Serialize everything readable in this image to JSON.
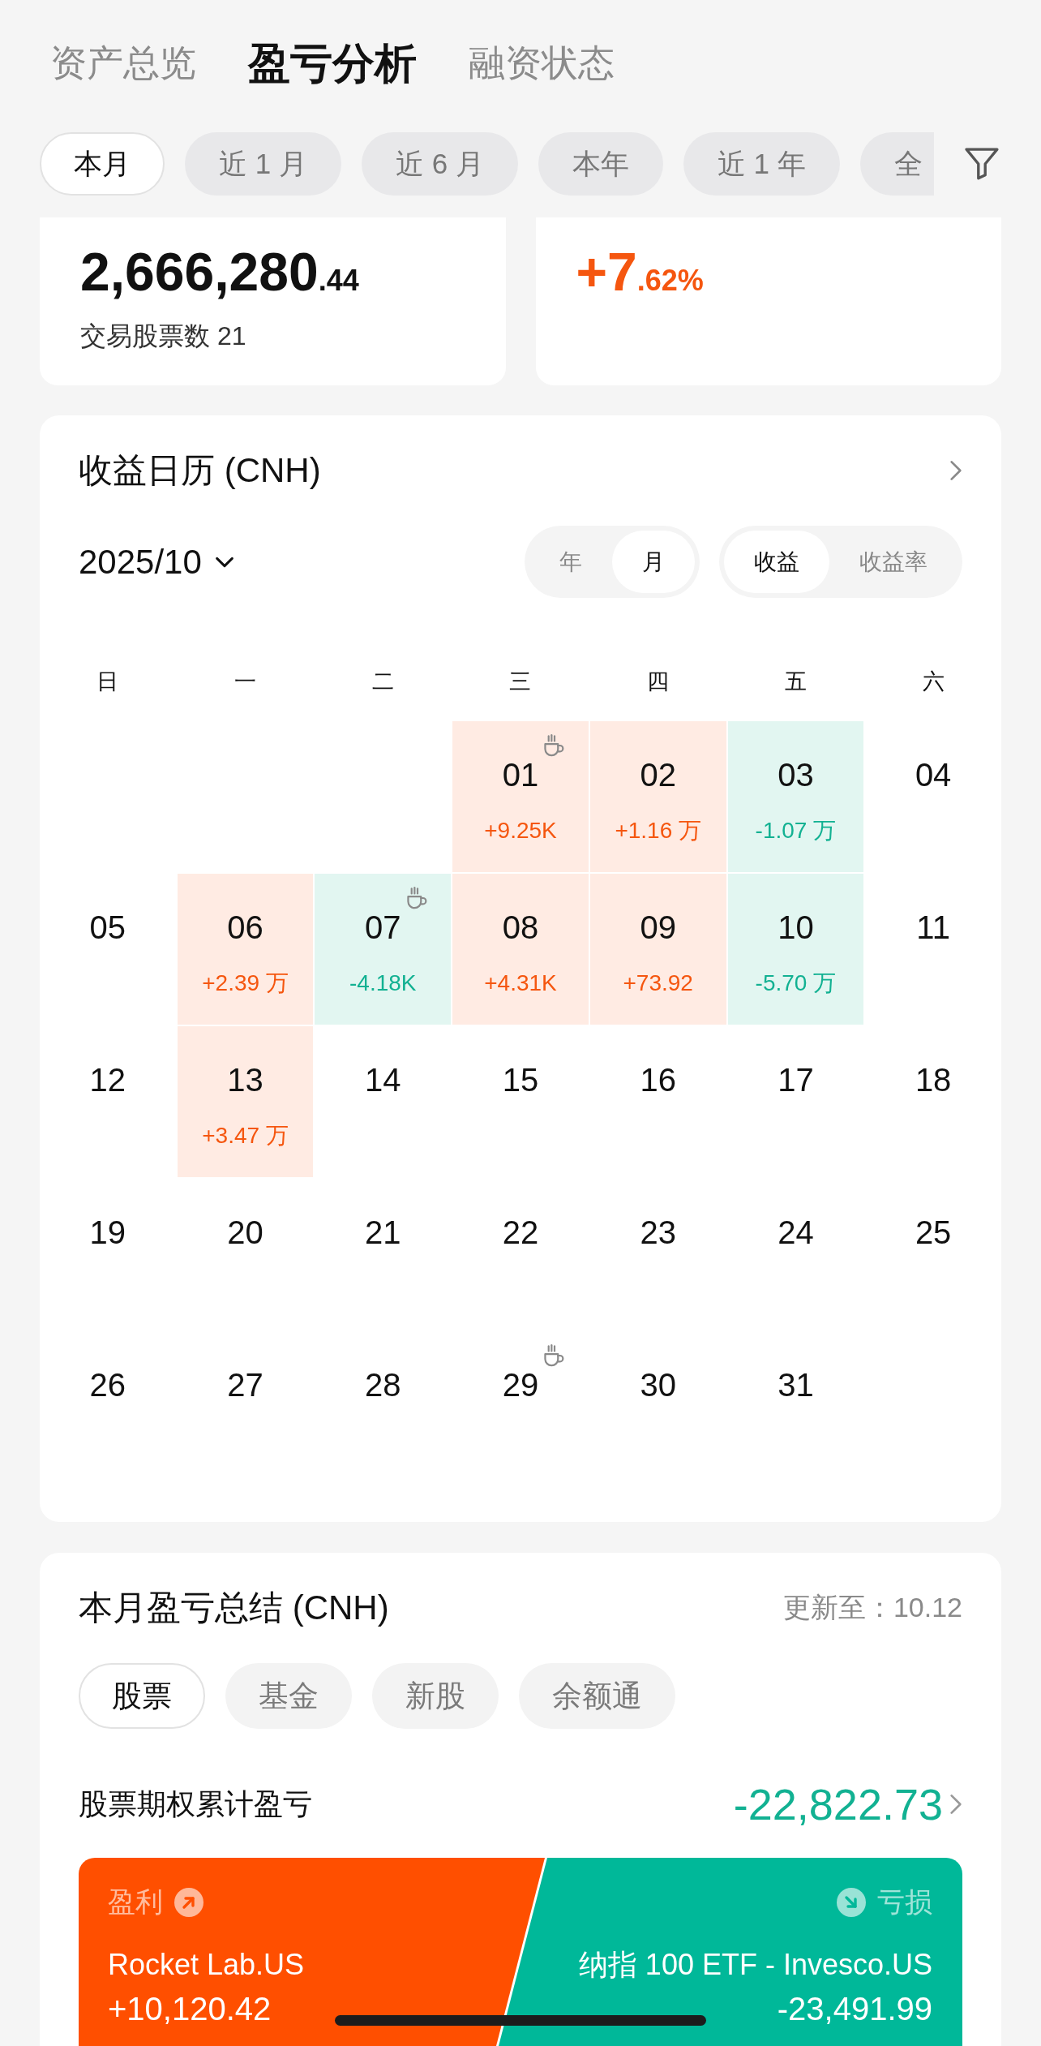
{
  "top_tabs": [
    {
      "label": "资产总览",
      "selected": false
    },
    {
      "label": "盈亏分析",
      "selected": true
    },
    {
      "label": "融资状态",
      "selected": false
    }
  ],
  "period_chips": [
    {
      "label": "本月",
      "selected": true
    },
    {
      "label": "近 1 月",
      "selected": false
    },
    {
      "label": "近 6 月",
      "selected": false
    },
    {
      "label": "本年",
      "selected": false
    },
    {
      "label": "近 1 年",
      "selected": false
    },
    {
      "label": "全",
      "selected": false
    }
  ],
  "stat_cards": [
    {
      "kind": "plain",
      "value": "2,666,280",
      "decimals": ".44",
      "caption": "交易股票数 21"
    },
    {
      "kind": "gain",
      "value": "+7",
      "decimals": ".62%"
    }
  ],
  "calendar": {
    "title": "收益日历 (CNH)",
    "month": "2025/10",
    "toggles": [
      {
        "options": [
          {
            "label": "年",
            "selected": false
          },
          {
            "label": "月",
            "selected": true
          }
        ]
      },
      {
        "options": [
          {
            "label": "收益",
            "selected": true
          },
          {
            "label": "收益率",
            "selected": false
          }
        ]
      }
    ],
    "weekdays": [
      "日",
      "一",
      "二",
      "三",
      "四",
      "五",
      "六"
    ],
    "weeks": [
      [
        {
          "kind": "blank"
        },
        {
          "kind": "blank"
        },
        {
          "kind": "blank"
        },
        {
          "kind": "gain",
          "day": "01",
          "value": "+9.25K",
          "cup": true
        },
        {
          "kind": "gain",
          "day": "02",
          "value": "+1.16 万",
          "cup": false
        },
        {
          "kind": "loss",
          "day": "03",
          "value": "-1.07 万",
          "cup": false
        },
        {
          "kind": "plain",
          "day": "04",
          "cup": false
        }
      ],
      [
        {
          "kind": "plain",
          "day": "05",
          "cup": false
        },
        {
          "kind": "gain",
          "day": "06",
          "value": "+2.39 万",
          "cup": false
        },
        {
          "kind": "loss",
          "day": "07",
          "value": "-4.18K",
          "cup": true
        },
        {
          "kind": "gain",
          "day": "08",
          "value": "+4.31K",
          "cup": false
        },
        {
          "kind": "gain",
          "day": "09",
          "value": "+73.92",
          "cup": false
        },
        {
          "kind": "loss",
          "day": "10",
          "value": "-5.70 万",
          "cup": false
        },
        {
          "kind": "plain",
          "day": "11",
          "cup": false
        }
      ],
      [
        {
          "kind": "plain",
          "day": "12",
          "cup": false
        },
        {
          "kind": "gain",
          "day": "13",
          "value": "+3.47 万",
          "cup": false
        },
        {
          "kind": "plain",
          "day": "14",
          "cup": false
        },
        {
          "kind": "plain",
          "day": "15",
          "cup": false
        },
        {
          "kind": "plain",
          "day": "16",
          "cup": false
        },
        {
          "kind": "plain",
          "day": "17",
          "cup": false
        },
        {
          "kind": "plain",
          "day": "18",
          "cup": false
        }
      ],
      [
        {
          "kind": "plain",
          "day": "19",
          "cup": false
        },
        {
          "kind": "plain",
          "day": "20",
          "cup": false
        },
        {
          "kind": "plain",
          "day": "21",
          "cup": false
        },
        {
          "kind": "plain",
          "day": "22",
          "cup": false
        },
        {
          "kind": "plain",
          "day": "23",
          "cup": false
        },
        {
          "kind": "plain",
          "day": "24",
          "cup": false
        },
        {
          "kind": "plain",
          "day": "25",
          "cup": false
        }
      ],
      [
        {
          "kind": "plain",
          "day": "26",
          "cup": false
        },
        {
          "kind": "plain",
          "day": "27",
          "cup": false
        },
        {
          "kind": "plain",
          "day": "28",
          "cup": false
        },
        {
          "kind": "plain",
          "day": "29",
          "cup": true
        },
        {
          "kind": "plain",
          "day": "30",
          "cup": false
        },
        {
          "kind": "plain",
          "day": "31",
          "cup": false
        },
        {
          "kind": "blank"
        }
      ]
    ]
  },
  "summary": {
    "title": "本月盈亏总结 (CNH)",
    "updated": "更新至：10.12",
    "tabs": [
      {
        "label": "股票",
        "selected": true
      },
      {
        "label": "基金",
        "selected": false
      },
      {
        "label": "新股",
        "selected": false
      },
      {
        "label": "余额通",
        "selected": false
      }
    ],
    "total_label": "股票期权累计盈亏",
    "total_value": "-22,822.73",
    "profit": {
      "label": "盈利",
      "name": "Rocket Lab.US",
      "value": "+10,120.42"
    },
    "loss": {
      "label": "亏损",
      "name": "纳指 100 ETF - Invesco.US",
      "value": "-23,491.99"
    }
  }
}
